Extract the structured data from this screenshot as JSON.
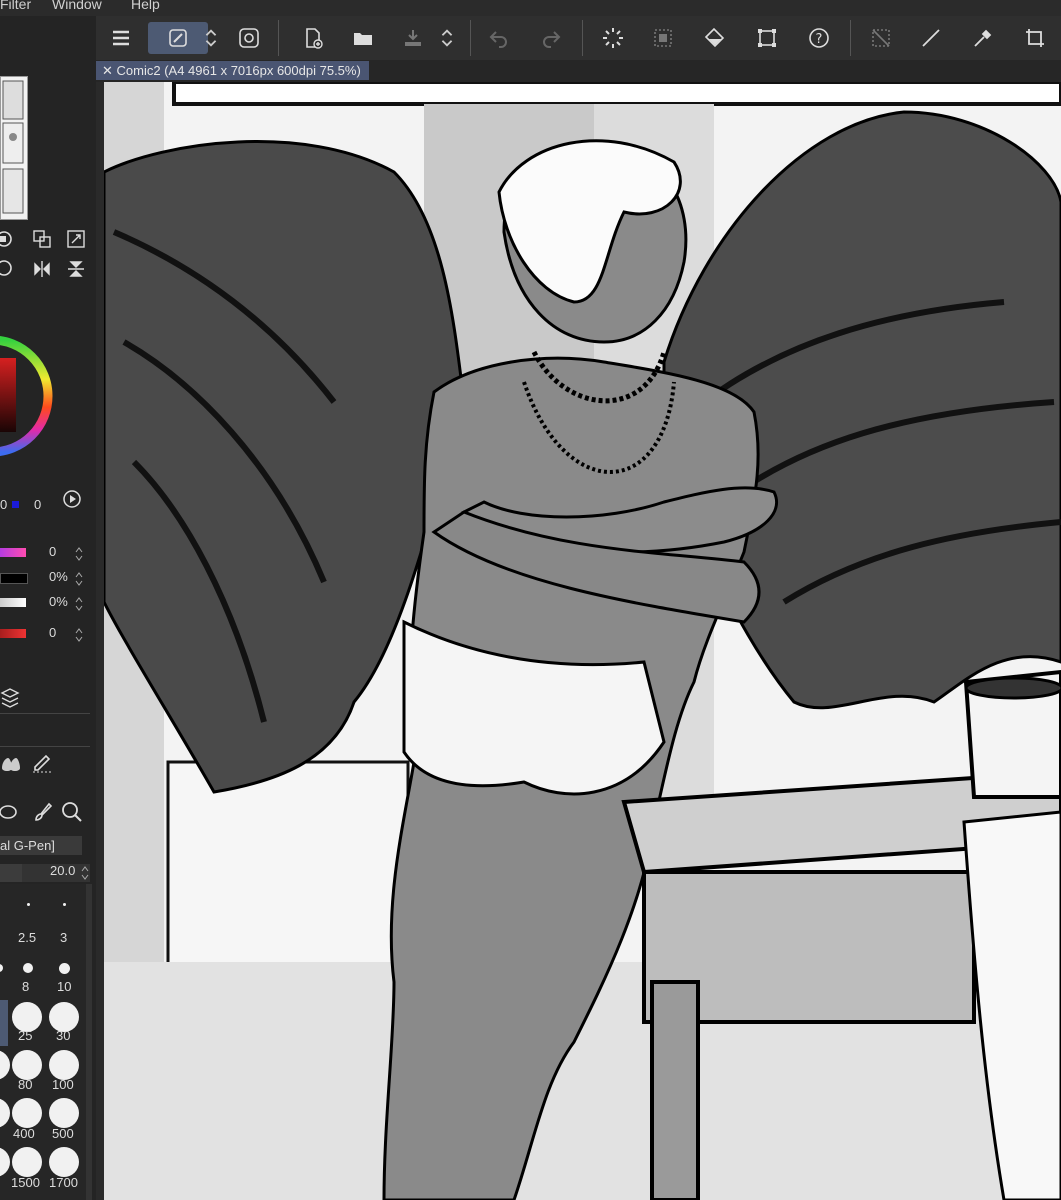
{
  "menubar": {
    "items": [
      "Filter",
      "Window",
      "Help"
    ]
  },
  "toolbar": {
    "buttons": [
      "menu-icon",
      "pen-tool-icon",
      "chevron-updown-icon",
      "swirl-icon",
      "new-file-icon",
      "open-folder-icon",
      "export-icon",
      "chevron-updown-icon",
      "undo-icon",
      "redo-icon",
      "loading-icon",
      "selection-icon",
      "fill-icon",
      "transform-icon",
      "help-icon",
      "deselect-icon",
      "line-icon",
      "eyedropper-icon",
      "crop-icon"
    ]
  },
  "document_tab": {
    "close": "✕",
    "title": "Comic2 (A4 4961 x 7016px 600dpi 75.5%)"
  },
  "left_panel": {
    "color_values": {
      "v1": "0",
      "v2": "0"
    },
    "layers": [
      {
        "value": "0",
        "color": "#c43cd8"
      },
      {
        "value": "0%",
        "color": "#000000"
      },
      {
        "value": "0%",
        "color": "#e8e8e8"
      },
      {
        "value": "0",
        "color": "#cc2a2a"
      }
    ],
    "brush_name": "al G-Pen]",
    "brush_size": "20.0",
    "brush_sizes": [
      {
        "label": "2.5"
      },
      {
        "label": "3"
      },
      {
        "label": "8"
      },
      {
        "label": "10"
      },
      {
        "label": "25"
      },
      {
        "label": "30"
      },
      {
        "label": "80"
      },
      {
        "label": "100"
      },
      {
        "label": "400"
      },
      {
        "label": "500"
      },
      {
        "label": "1500"
      },
      {
        "label": "1700"
      }
    ]
  },
  "colors": {
    "accent": "#4d5a73",
    "panel": "#242424",
    "toolbar": "#2f2f2f",
    "canvas": "#f4f4f4"
  }
}
